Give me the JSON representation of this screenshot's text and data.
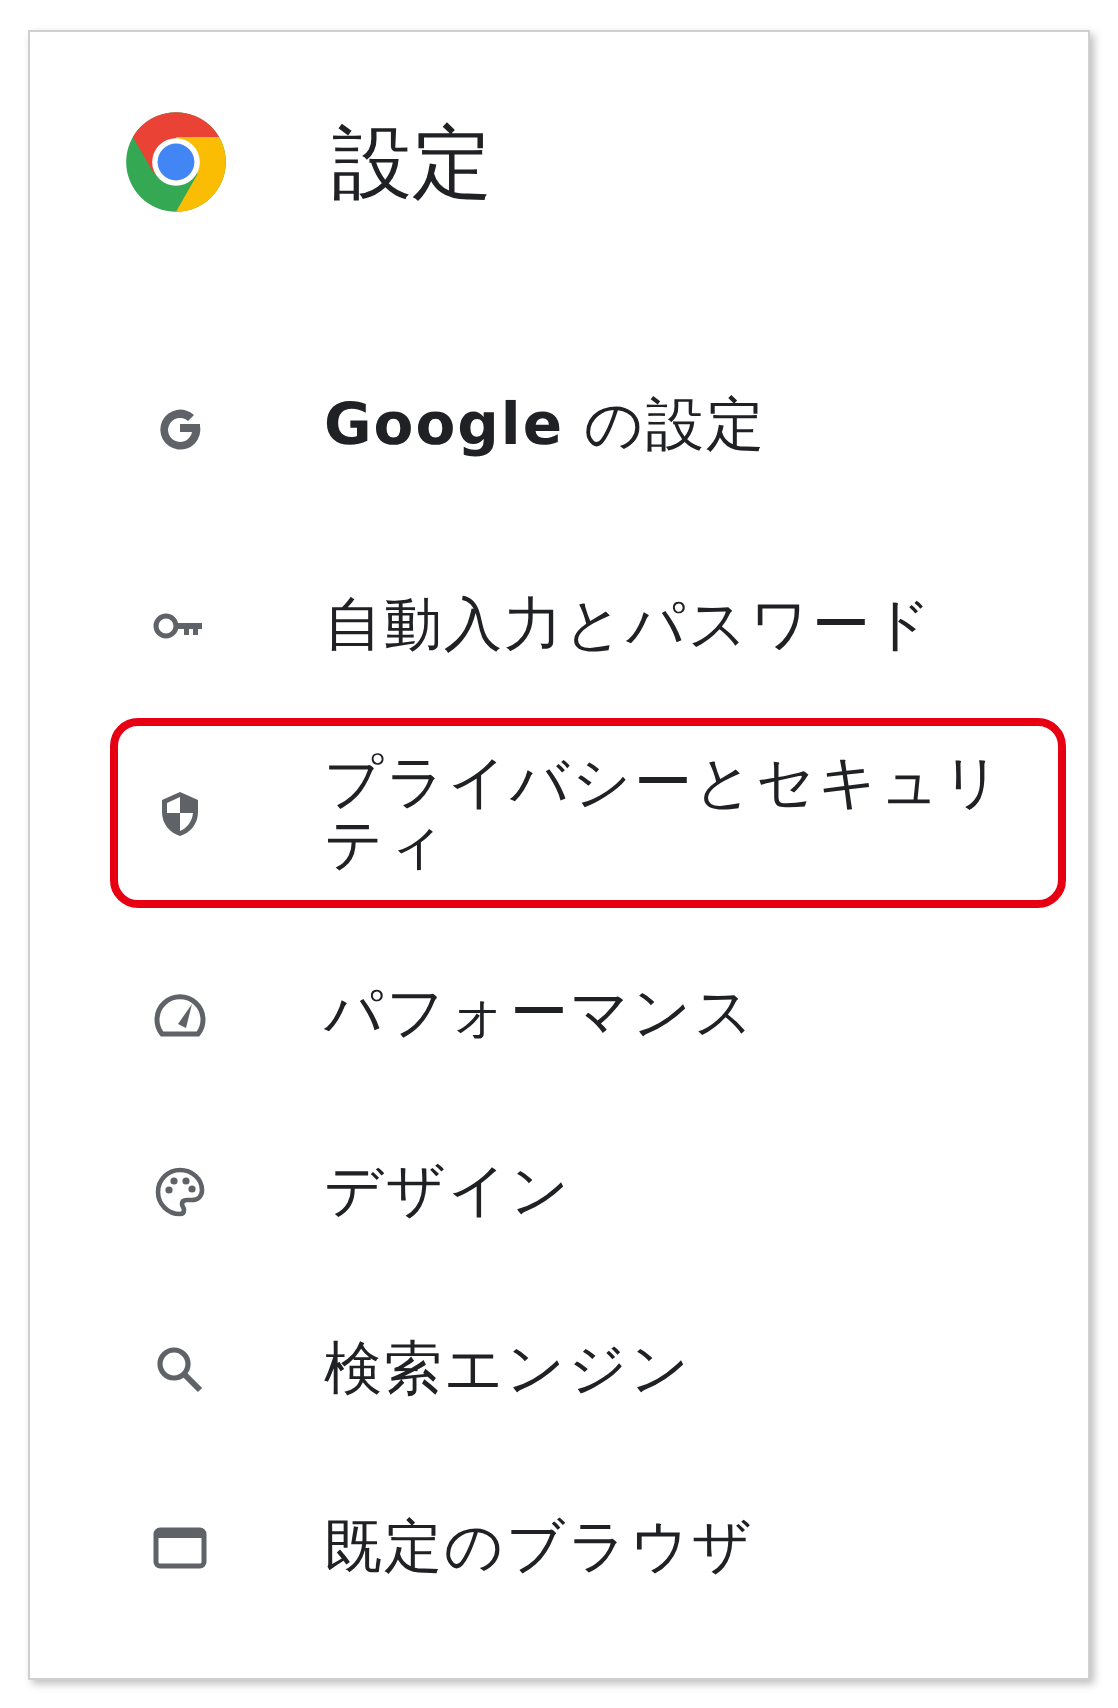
{
  "header": {
    "title": "設定"
  },
  "menu": [
    {
      "label": "**Google** の設定",
      "highlighted": false
    },
    {
      "label": "自動入力とパスワード",
      "highlighted": false
    },
    {
      "label": "プライバシーとセキュリティ",
      "highlighted": true
    },
    {
      "label": "パフォーマンス",
      "highlighted": false
    },
    {
      "label": "デザイン",
      "highlighted": false
    },
    {
      "label": "検索エンジン",
      "highlighted": false
    },
    {
      "label": "既定のブラウザ",
      "highlighted": false
    }
  ]
}
